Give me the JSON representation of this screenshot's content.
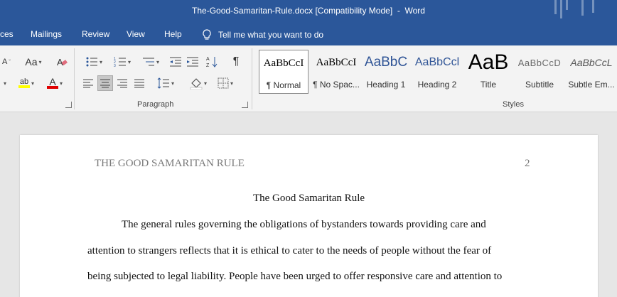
{
  "window": {
    "doc_name": "The-Good-Samaritan-Rule.docx",
    "mode": "[Compatibility Mode]",
    "separator": "-",
    "app": "Word"
  },
  "menu": {
    "items": [
      "ces",
      "Mailings",
      "Review",
      "View",
      "Help"
    ],
    "tell_me": "Tell me what you want to do"
  },
  "ribbon": {
    "font_group": {
      "change_case": "Aa",
      "font_color": "A",
      "highlight": "ab"
    },
    "paragraph_label": "Paragraph",
    "styles_label": "Styles",
    "styles": [
      {
        "sample": "AaBbCcI",
        "name": "¶ Normal"
      },
      {
        "sample": "AaBbCcI",
        "name": "¶ No Spac..."
      },
      {
        "sample": "AaBbC",
        "name": "Heading 1"
      },
      {
        "sample": "AaBbCcl",
        "name": "Heading 2"
      },
      {
        "sample": "AaB",
        "name": "Title"
      },
      {
        "sample": "AaBbCcD",
        "name": "Subtitle"
      },
      {
        "sample": "AaBbCcL",
        "name": "Subtle Em..."
      }
    ]
  },
  "document": {
    "running_head": "THE GOOD SAMARITAN RULE",
    "page_number": "2",
    "title": "The Good Samaritan Rule",
    "lines": [
      "The general rules governing the obligations of bystanders towards providing care and",
      "attention to strangers reflects that it is ethical to cater to the needs of people without the fear of",
      "being subjected to legal liability. People have been urged to offer responsive care and attention to"
    ]
  },
  "colors": {
    "title_bar": "#2b579a",
    "ribbon": "#f3f3f3",
    "canvas": "#e6e6e6",
    "heading_blue": "#2f5496"
  }
}
